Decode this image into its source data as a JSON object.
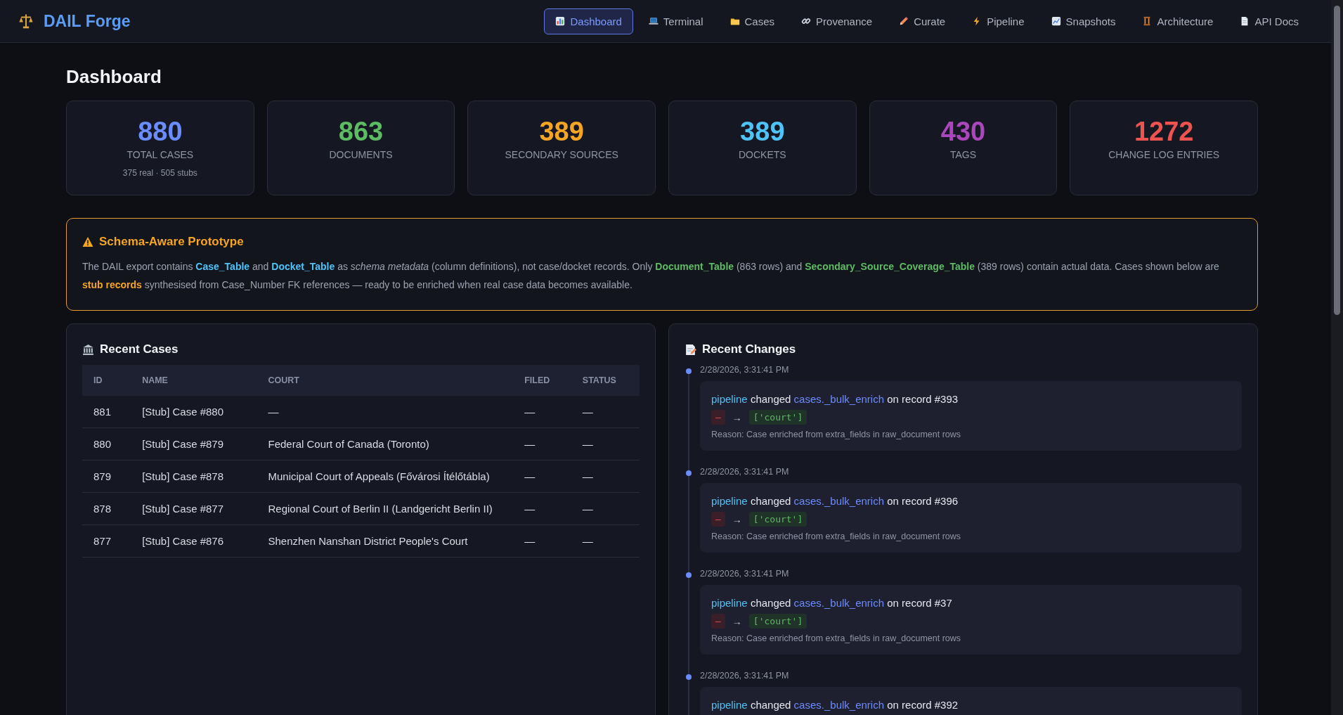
{
  "app": {
    "title": "DAIL Forge"
  },
  "nav": [
    {
      "label": "Dashboard",
      "selected": true
    },
    {
      "label": "Terminal",
      "selected": false
    },
    {
      "label": "Cases",
      "selected": false
    },
    {
      "label": "Provenance",
      "selected": false
    },
    {
      "label": "Curate",
      "selected": false
    },
    {
      "label": "Pipeline",
      "selected": false
    },
    {
      "label": "Snapshots",
      "selected": false
    },
    {
      "label": "Architecture",
      "selected": false
    },
    {
      "label": "API Docs",
      "selected": false
    }
  ],
  "page_title": "Dashboard",
  "stats": [
    {
      "value": "880",
      "label": "TOTAL CASES",
      "note": "375 real · 505 stubs",
      "color": "#6b8cff"
    },
    {
      "value": "863",
      "label": "DOCUMENTS",
      "color": "#5dbb63"
    },
    {
      "value": "389",
      "label": "SECONDARY SOURCES",
      "color": "#f5a524"
    },
    {
      "value": "389",
      "label": "DOCKETS",
      "color": "#4fc3f7"
    },
    {
      "value": "430",
      "label": "TAGS",
      "color": "#ab47bc"
    },
    {
      "value": "1272",
      "label": "CHANGE LOG ENTRIES",
      "color": "#ef5350"
    }
  ],
  "notice": {
    "title": "Schema-Aware Prototype",
    "segments": [
      {
        "kind": "plain",
        "text": "The DAIL export contains "
      },
      {
        "kind": "schema",
        "text": "Case_Table"
      },
      {
        "kind": "plain",
        "text": " and "
      },
      {
        "kind": "schema",
        "text": "Docket_Table"
      },
      {
        "kind": "plain",
        "text": " as "
      },
      {
        "kind": "em",
        "text": "schema metadata"
      },
      {
        "kind": "plain",
        "text": " (column definitions), not case/docket records. Only "
      },
      {
        "kind": "data",
        "text": "Document_Table"
      },
      {
        "kind": "plain",
        "text": " (863 rows) and "
      },
      {
        "kind": "data",
        "text": "Secondary_Source_Coverage_Table"
      },
      {
        "kind": "plain",
        "text": " (389 rows) contain actual data. Cases shown below are "
      },
      {
        "kind": "stub",
        "text": "stub records"
      },
      {
        "kind": "plain",
        "text": " synthesised from Case_Number FK references — ready to be enriched when real case data becomes available."
      }
    ]
  },
  "recent_cases": {
    "title": "Recent Cases",
    "columns": [
      "ID",
      "NAME",
      "COURT",
      "FILED",
      "STATUS"
    ],
    "rows": [
      [
        "881",
        "[Stub] Case #880",
        "—",
        "—",
        "—"
      ],
      [
        "880",
        "[Stub] Case #879",
        "Federal Court of Canada (Toronto)",
        "—",
        "—"
      ],
      [
        "879",
        "[Stub] Case #878",
        "Municipal Court of Appeals (Fővárosi Ítélőtábla)",
        "—",
        "—"
      ],
      [
        "878",
        "[Stub] Case #877",
        "Regional Court of Berlin II (Landgericht Berlin II)",
        "—",
        "—"
      ],
      [
        "877",
        "[Stub] Case #876",
        "Shenzhen Nanshan District People's Court",
        "—",
        "—"
      ]
    ]
  },
  "recent_changes": {
    "title": "Recent Changes",
    "entries": [
      {
        "time": "2/28/2026, 3:31:41 PM",
        "actor": "pipeline",
        "verb": " changed ",
        "target": "cases._bulk_enrich",
        "record": " on record #393",
        "old": "—",
        "arrow": "→",
        "new": "['court']",
        "reason": "Reason: Case enriched from extra_fields in raw_document rows"
      },
      {
        "time": "2/28/2026, 3:31:41 PM",
        "actor": "pipeline",
        "verb": " changed ",
        "target": "cases._bulk_enrich",
        "record": " on record #396",
        "old": "—",
        "arrow": "→",
        "new": "['court']",
        "reason": "Reason: Case enriched from extra_fields in raw_document rows"
      },
      {
        "time": "2/28/2026, 3:31:41 PM",
        "actor": "pipeline",
        "verb": " changed ",
        "target": "cases._bulk_enrich",
        "record": " on record #37",
        "old": "—",
        "arrow": "→",
        "new": "['court']",
        "reason": "Reason: Case enriched from extra_fields in raw_document rows"
      },
      {
        "time": "2/28/2026, 3:31:41 PM",
        "actor": "pipeline",
        "verb": " changed ",
        "target": "cases._bulk_enrich",
        "record": " on record #392"
      }
    ]
  }
}
